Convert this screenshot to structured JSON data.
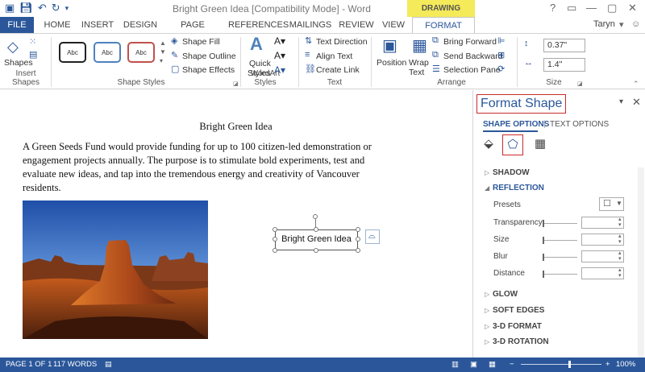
{
  "title_bar": {
    "document_title": "Bright Green Idea [Compatibility Mode] - Word",
    "contextual_tab_group": "DRAWING TOOLS",
    "quick_access": [
      "save-icon",
      "undo-icon",
      "redo-icon",
      "customize-icon"
    ],
    "window_controls": [
      "help-icon",
      "ribbon-display-icon",
      "minimize-icon",
      "maximize-icon",
      "close-icon"
    ]
  },
  "ribbon_tabs": {
    "file": "FILE",
    "items": [
      "HOME",
      "INSERT",
      "DESIGN",
      "PAGE LAYOUT",
      "REFERENCES",
      "MAILINGS",
      "REVIEW",
      "VIEW"
    ],
    "active": "FORMAT",
    "user": "Taryn"
  },
  "ribbon": {
    "insert_shapes": {
      "shapes_label": "Shapes",
      "group_label": "Insert Shapes"
    },
    "shape_styles": {
      "thumb_label": "Abc",
      "thumb_colors": [
        "#222222",
        "#4f81bd",
        "#c0504d"
      ],
      "shape_fill": "Shape Fill",
      "shape_outline": "Shape Outline",
      "shape_effects": "Shape Effects",
      "group_label": "Shape Styles"
    },
    "wordart": {
      "quick_styles_line1": "Quick",
      "quick_styles_line2": "Styles",
      "group_label": "WordArt Styles"
    },
    "text": {
      "text_direction": "Text Direction",
      "align_text": "Align Text",
      "create_link": "Create Link",
      "group_label": "Text"
    },
    "arrange": {
      "position": "Position",
      "wrap_text_line1": "Wrap",
      "wrap_text_line2": "Text",
      "bring_forward": "Bring Forward",
      "send_backward": "Send Backward",
      "selection_pane": "Selection Pane",
      "group_label": "Arrange"
    },
    "size": {
      "height": "0.37\"",
      "width": "1.4\"",
      "group_label": "Size"
    }
  },
  "document": {
    "heading": "Bright Green Idea",
    "paragraph": "A Green Seeds Fund would provide funding for up to 100 citizen-led demonstration or engagement projects annually. The purpose is to stimulate bold experiments, test and evaluate new ideas, and tap into the tremendous energy and creativity of Vancouver residents.",
    "textbox_text": "Bright Green Idea"
  },
  "format_pane": {
    "title": "Format Shape",
    "tabs": {
      "shape_options": "SHAPE OPTIONS",
      "text_options": "TEXT OPTIONS"
    },
    "sections": {
      "shadow": "SHADOW",
      "reflection": "REFLECTION",
      "glow": "GLOW",
      "soft_edges": "SOFT EDGES",
      "three_d_format": "3-D FORMAT",
      "three_d_rotation": "3-D ROTATION"
    },
    "reflection_props": {
      "presets": "Presets",
      "transparency": "Transparency",
      "size": "Size",
      "blur": "Blur",
      "distance": "Distance"
    }
  },
  "status_bar": {
    "page": "PAGE 1 OF 1",
    "words": "117 WORDS",
    "zoom": "100%"
  },
  "colors": {
    "accent": "#2b579a",
    "contextual_tab": "#f4ea5a",
    "highlight_border": "#c92a2a"
  }
}
